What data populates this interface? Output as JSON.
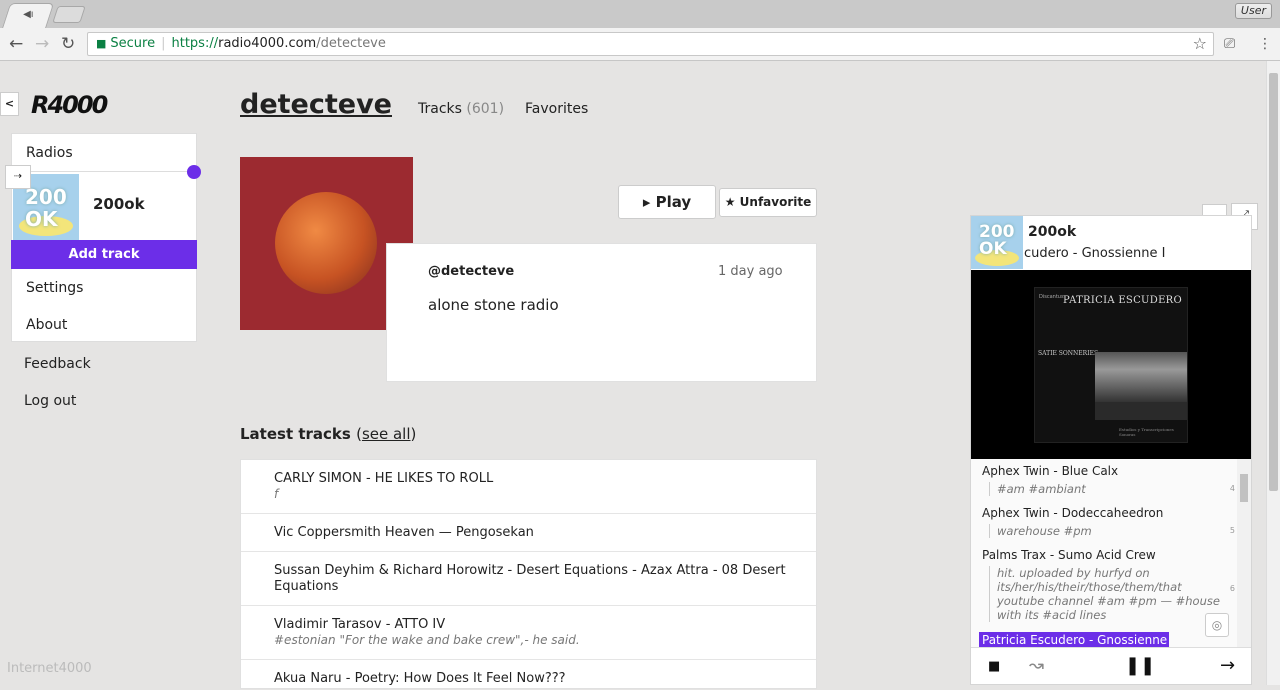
{
  "browser": {
    "tab_icon": "speaker-icon",
    "user_label": "User",
    "address": {
      "secure_label": "Secure",
      "scheme": "https://",
      "host": "radio4000.com",
      "path": "/detecteve"
    }
  },
  "sidebar": {
    "logo": "R4000",
    "collapse_label": "<",
    "move_label": "⇢",
    "radios_label": "Radios",
    "current_radio": {
      "name": "200ok",
      "thumb_text_1": "200",
      "thumb_text_2": "OK"
    },
    "add_track_label": "Add track",
    "settings_label": "Settings",
    "about_label": "About",
    "feedback_label": "Feedback",
    "logout_label": "Log out",
    "footer": "Internet4000"
  },
  "channel": {
    "title": "detecteve",
    "tabs": {
      "tracks_label": "Tracks",
      "tracks_count": "(601)",
      "favorites_label": "Favorites"
    },
    "play_label": "▸ Play",
    "unfavorite_label": "★ Unfavorite",
    "handle": "@detecteve",
    "updated": "1 day ago",
    "description": "alone stone radio"
  },
  "latest": {
    "heading": "Latest tracks",
    "see_all_open": "(",
    "see_all_label": "see all",
    "see_all_close": ")",
    "tracks": [
      {
        "title": "CARLY SIMON - HE LIKES TO ROLL",
        "desc": "f"
      },
      {
        "title": "Vic Coppersmith Heaven — Pengosekan",
        "desc": ""
      },
      {
        "title": "Sussan Deyhim & Richard Horowitz - Desert Equations - Azax Attra - 08 Desert Equations",
        "desc": ""
      },
      {
        "title": "Vladimir Tarasov - ATTO IV",
        "desc": "#estonian \"For the wake and bake crew\",- he said."
      },
      {
        "title": "Akua Naru - Poetry: How Does It Feel Now???",
        "desc": ""
      }
    ]
  },
  "player": {
    "channel": "200ok",
    "now_playing": "cudero - Gnossienne I",
    "minimize_label": "_",
    "expand_label": "⤢",
    "album": {
      "artist": "PATRICIA ESCUDERO",
      "subtitle": "SATIE SONNERIES",
      "brand": "Discantus",
      "caption": "Estudios y Transcripciones Sonoras"
    },
    "queue": [
      {
        "title": "Aphex Twin - Blue Calx",
        "desc": "#am #ambiant",
        "num": "4"
      },
      {
        "title": "Aphex Twin - Dodeccaheedron",
        "desc": "warehouse #pm",
        "num": "5"
      },
      {
        "title": "Palms Trax - Sumo Acid Crew",
        "desc": "hit. uploaded by hurfyd on its/her/his/their/those/them/that youtube channel #am #pm — #house with its #acid lines",
        "num": "6"
      }
    ],
    "active_track": "Patricia Escudero - Gnossienne I",
    "locate_icon": "◎",
    "controls": {
      "stop": "■",
      "shuffle": "↝",
      "pause": "❚❚",
      "next": "→"
    }
  }
}
